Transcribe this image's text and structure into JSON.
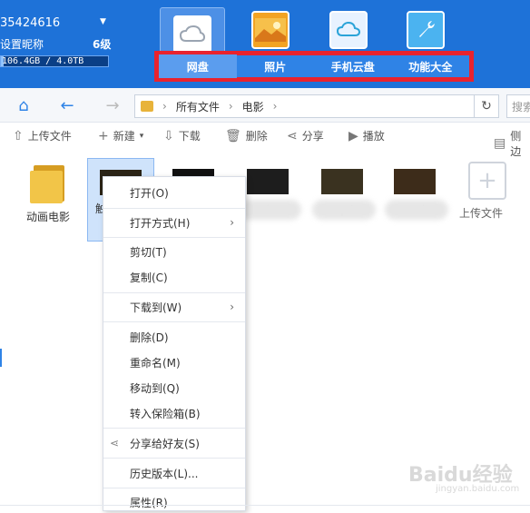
{
  "header": {
    "user_id": "35424616",
    "nickname_label": "设置昵称",
    "level": "6级",
    "quota_text": "106.4GB / 4.0TB",
    "quota_fraction": 0.026
  },
  "tabs": [
    {
      "label": "网盘"
    },
    {
      "label": "照片"
    },
    {
      "label": "手机云盘"
    },
    {
      "label": "功能大全"
    }
  ],
  "breadcrumb": {
    "root": "所有文件",
    "current": "电影"
  },
  "search": {
    "placeholder": "搜索"
  },
  "toolbar": {
    "upload": "上传文件",
    "new": "新建",
    "download": "下载",
    "delete": "删除",
    "share": "分享",
    "play": "播放",
    "view_mode": "侧边"
  },
  "files": [
    {
      "name": "动画电影"
    },
    {
      "name": "触"
    },
    {
      "name": ""
    },
    {
      "name": "mkv"
    },
    {
      "name": "mp4"
    },
    {
      "name": "rmvb"
    }
  ],
  "upload_tile": {
    "label": "上传文件"
  },
  "context_menu": {
    "open": "打开(O)",
    "open_with": "打开方式(H)",
    "cut": "剪切(T)",
    "copy": "复制(C)",
    "download_to": "下载到(W)",
    "delete": "删除(D)",
    "rename": "重命名(M)",
    "move_to": "移动到(Q)",
    "to_safe": "转入保险箱(B)",
    "share_friend": "分享给好友(S)",
    "history": "历史版本(L)...",
    "properties": "属性(R)"
  },
  "watermark": {
    "brand": "Baidu经验",
    "url": "jingyan.baidu.com"
  }
}
